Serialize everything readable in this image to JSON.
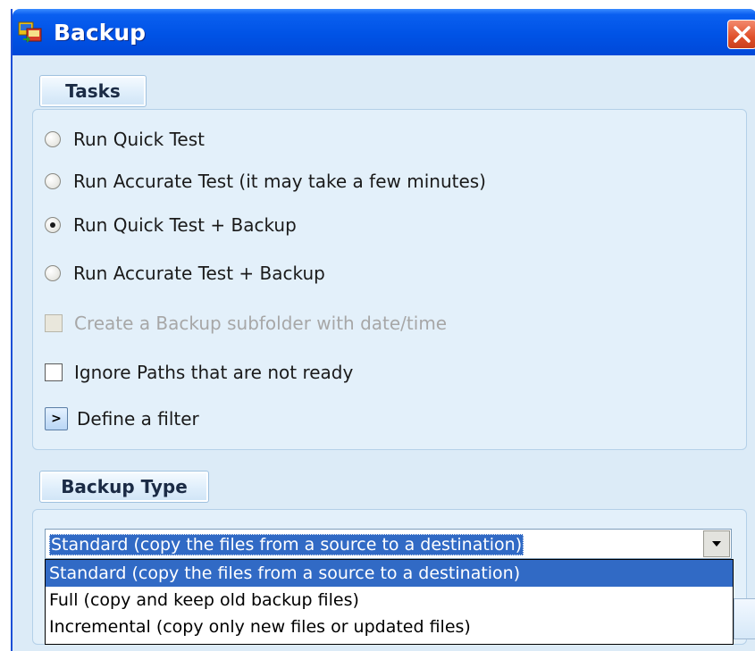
{
  "window": {
    "title": "Backup",
    "app_icon": "backup-app-icon",
    "close_icon": "close-icon",
    "accent_color": "#0053e6"
  },
  "tasks": {
    "section_label": "Tasks",
    "options": [
      {
        "label": "Run Quick Test",
        "type": "radio",
        "checked": false
      },
      {
        "label": "Run Accurate Test (it may take a few minutes)",
        "type": "radio",
        "checked": false
      },
      {
        "label": "Run Quick Test + Backup",
        "type": "radio",
        "checked": true
      },
      {
        "label": "Run Accurate Test + Backup",
        "type": "radio",
        "checked": false
      }
    ],
    "subfolder_checkbox": {
      "label": "Create a Backup subfolder with date/time",
      "checked": false,
      "enabled": false
    },
    "ignore_paths_checkbox": {
      "label": "Ignore Paths that are not ready",
      "checked": false,
      "enabled": true
    },
    "filter": {
      "button_label": ">",
      "label": "Define a filter"
    }
  },
  "backup_type": {
    "section_label": "Backup Type",
    "selected": "Standard (copy the files from a source to a destination)",
    "options": [
      "Standard (copy the files from a source to a destination)",
      "Full (copy and keep old backup files)",
      "Incremental (copy only new files or updated files)"
    ],
    "highlight_color": "#316ac5"
  }
}
